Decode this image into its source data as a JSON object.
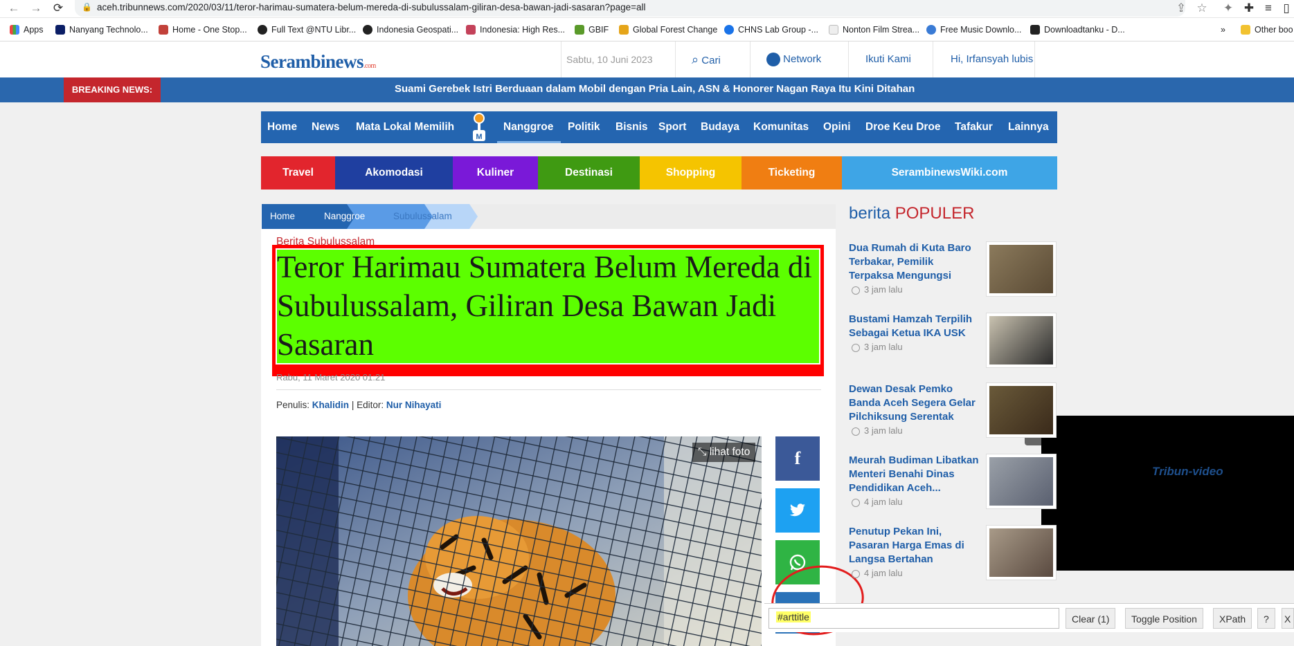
{
  "browser": {
    "url": "aceh.tribunnews.com/2020/03/11/teror-harimau-sumatera-belum-mereda-di-subulussalam-giliran-desa-bawan-jadi-sasaran?page=all",
    "bookmarks": [
      "Apps",
      "Nanyang Technolo...",
      "Home - One Stop...",
      "Full Text @NTU Libr...",
      "Indonesia Geospati...",
      "Indonesia: High Res...",
      "GBIF",
      "Global Forest Change",
      "CHNS Lab Group -...",
      "Nonton Film Strea...",
      "Free Music Downlo...",
      "Downloadtanku - D..."
    ],
    "other_bookmarks": "Other boo",
    "more_bookmarks": "»"
  },
  "header": {
    "logo_main": "Serambinews",
    "logo_suffix": ".com",
    "date": "Sabtu, 10 Juni 2023",
    "search": "Cari",
    "network": "Network",
    "follow": "Ikuti Kami",
    "user": "Hi, Irfansyah lubis"
  },
  "breaking": {
    "label": "BREAKING NEWS:",
    "text": "Suami Gerebek Istri Berduaan dalam Mobil dengan Pria Lain, ASN & Honorer Nagan Raya Itu Kini Ditahan"
  },
  "main_nav": [
    "Home",
    "News",
    "Mata Lokal Memilih",
    "Nanggroe",
    "Politik",
    "Bisnis",
    "Sport",
    "Budaya",
    "Komunitas",
    "Opini",
    "Droe Keu Droe",
    "Tafakur",
    "Lainnya"
  ],
  "color_nav": [
    {
      "label": "Travel",
      "color": "#e2252d"
    },
    {
      "label": "Akomodasi",
      "color": "#1f3fa0"
    },
    {
      "label": "Kuliner",
      "color": "#7a19d8"
    },
    {
      "label": "Destinasi",
      "color": "#3f9a12"
    },
    {
      "label": "Shopping",
      "color": "#f5c400"
    },
    {
      "label": "Ticketing",
      "color": "#f07e12"
    },
    {
      "label": "SerambinewsWiki.com",
      "color": "#3ea5e6"
    }
  ],
  "breadcrumb": [
    "Home",
    "Nanggroe",
    "Subulussalam"
  ],
  "article": {
    "kicker": "Berita Subulussalam",
    "title": "Teror Harimau Sumatera Belum Mereda di Subulussalam, Giliran Desa Bawan Jadi Sasaran",
    "date": "Rabu, 11 Maret 2020 01:21",
    "penulis_label": "Penulis:",
    "penulis": "Khalidin",
    "editor_label": "| Editor:",
    "editor": "Nur Nihayati",
    "lihat_foto": "lihat foto"
  },
  "share": [
    {
      "icon": "facebook-icon",
      "glyph": "f",
      "color": "#3b5998"
    },
    {
      "icon": "twitter-icon",
      "glyph": "🐦",
      "color": "#1da1f2"
    },
    {
      "icon": "whatsapp-icon",
      "glyph": "✆",
      "color": "#2fb444"
    },
    {
      "icon": "linkedin-icon",
      "glyph": "",
      "color": "#2a72b8"
    }
  ],
  "popular": {
    "heading_a": "berita",
    "heading_b": "POPULER",
    "items": [
      {
        "title": "Dua Rumah di Kuta Baro Terbakar, Pemilik Terpaksa Mengungsi",
        "time": "3 jam lalu"
      },
      {
        "title": "Bustami Hamzah Terpilih Sebagai Ketua IKA USK",
        "time": "3 jam lalu"
      },
      {
        "title": "Dewan Desak Pemko Banda Aceh Segera Gelar Pilchiksung Serentak",
        "time": "3 jam lalu"
      },
      {
        "title": "Meurah Budiman Libatkan Menteri Benahi Dinas Pendidikan Aceh...",
        "time": "4 jam lalu"
      },
      {
        "title": "Penutup Pekan Ini, Pasaran Harga Emas di Langsa Bertahan",
        "time": "4 jam lalu"
      }
    ]
  },
  "video": {
    "logo": "Tribun-video"
  },
  "selector_gadget": {
    "value": "#arttitle",
    "clear": "Clear (1)",
    "toggle": "Toggle Position",
    "xpath": "XPath",
    "help": "?",
    "close": "X"
  }
}
